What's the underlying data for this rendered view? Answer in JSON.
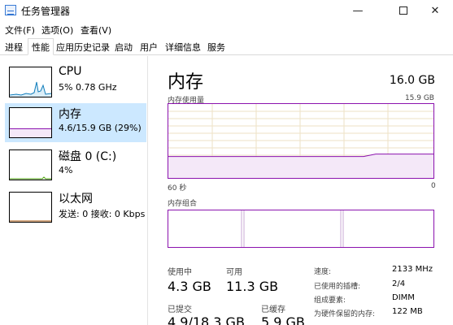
{
  "window": {
    "title": "任务管理器",
    "min_glyph": "—",
    "close_glyph": "✕"
  },
  "menu": [
    "文件(F)",
    "选项(O)",
    "查看(V)"
  ],
  "tabs": [
    "进程",
    "性能",
    "应用历史记录",
    "启动",
    "用户",
    "详细信息",
    "服务"
  ],
  "active_tab": "性能",
  "sidebar": {
    "items": [
      {
        "name": "CPU",
        "detail": "5% 0.78 GHz",
        "color": "#117dbb",
        "selected": false
      },
      {
        "name": "内存",
        "detail": "4.6/15.9 GB (29%)",
        "color": "#8b12ae",
        "selected": true,
        "level": 0.29
      },
      {
        "name": "磁盘 0 (C:)",
        "detail": "4%",
        "color": "#4da60c",
        "selected": false
      },
      {
        "name": "以太网",
        "detail": "发送: 0 接收: 0 Kbps",
        "color": "#a74f01",
        "selected": false
      }
    ]
  },
  "memory": {
    "title": "内存",
    "capacity": "16.0 GB",
    "usage_label": "内存使用量",
    "usage_max": "15.9 GB",
    "time_label": "60 秒",
    "zero_label": "0",
    "composition_label": "内存组合",
    "usage_level": 0.29,
    "stats": {
      "in_use_label": "使用中",
      "in_use": "4.3 GB",
      "available_label": "可用",
      "available": "11.3 GB",
      "committed_label": "已提交",
      "committed": "4.9/18.3 GB",
      "cached_label": "已缓存",
      "cached": "5.9 GB"
    },
    "specs": [
      {
        "label": "速度:",
        "value": "2133 MHz"
      },
      {
        "label": "已使用的插槽:",
        "value": "2/4"
      },
      {
        "label": "组成要素:",
        "value": "DIMM"
      },
      {
        "label": "为硬件保留的内存:",
        "value": "122 MB"
      }
    ]
  },
  "colors": {
    "memory_accent": "#8b12ae",
    "memory_fill": "#f4e8f8",
    "grid": "#ede2c6",
    "selected_bg": "#cce8ff"
  }
}
